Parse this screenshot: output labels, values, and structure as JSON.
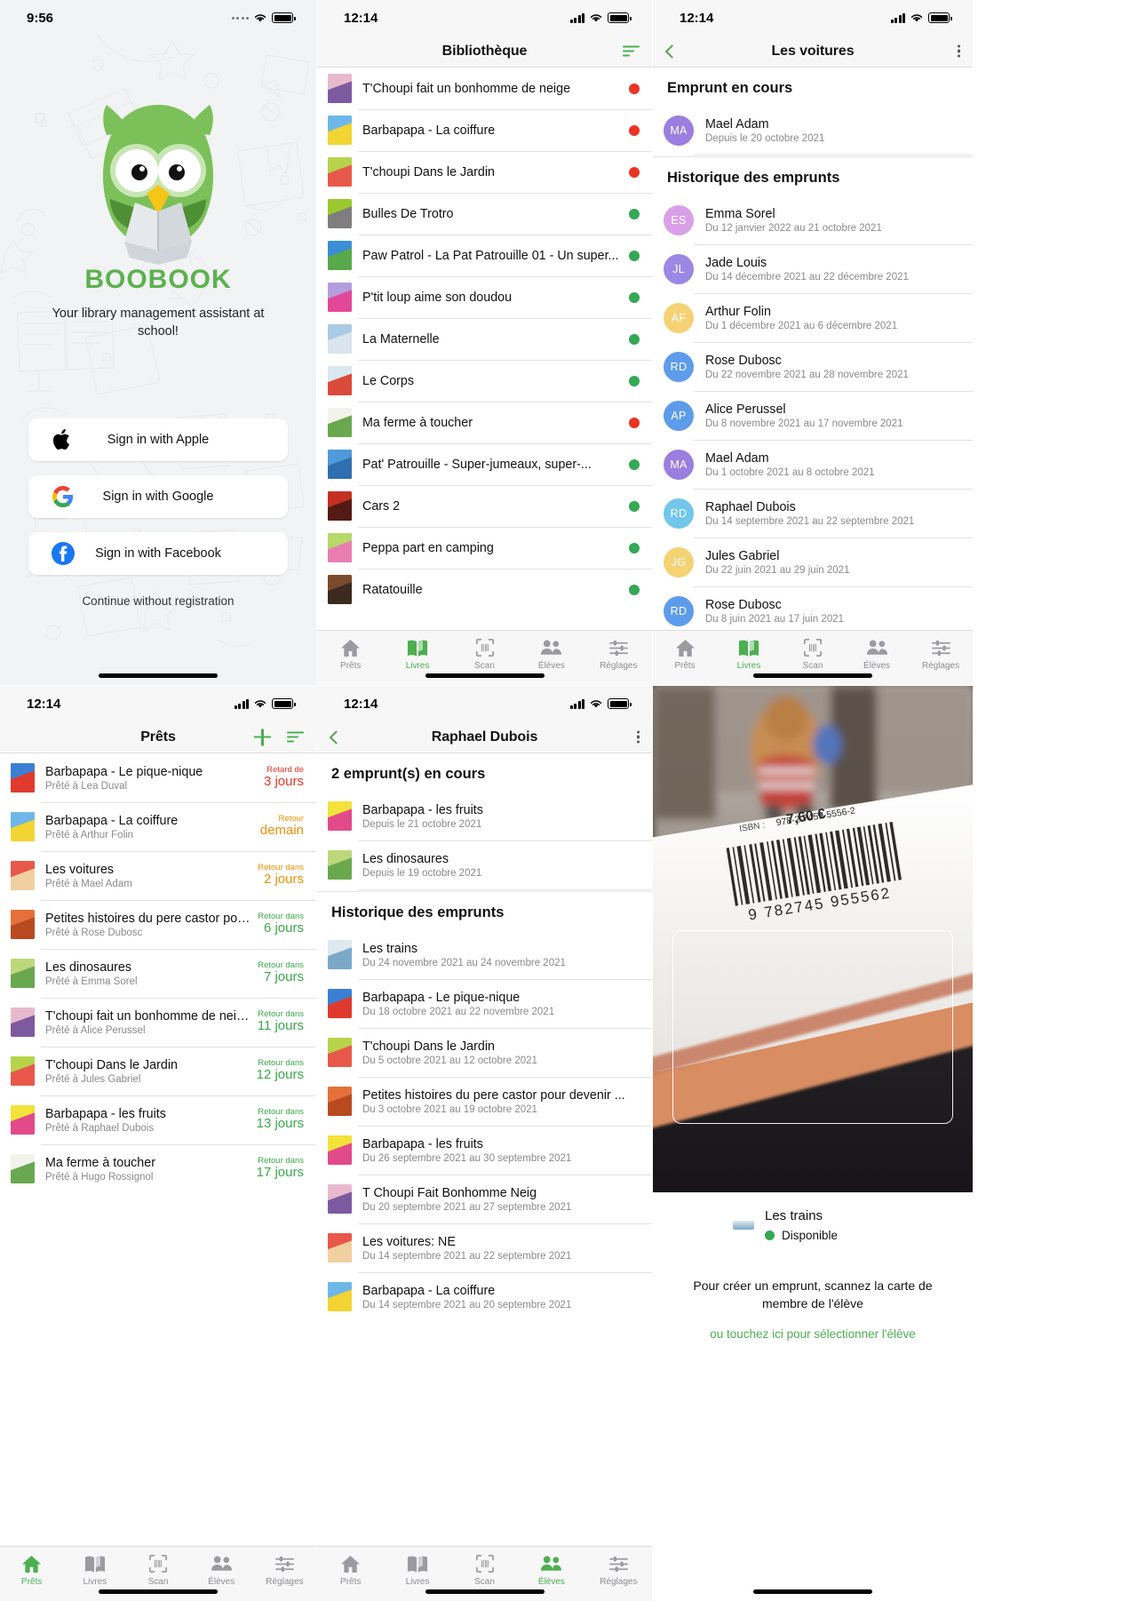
{
  "app": {
    "name": "BOOBOOK",
    "accent": "#4caf50"
  },
  "panel1": {
    "status": {
      "time": "9:56"
    },
    "brand": "BOOBOOK",
    "tagline": "Your library management assistant at school!",
    "buttons": [
      {
        "label": "Sign in with Apple",
        "icon": "apple-icon"
      },
      {
        "label": "Sign in with Google",
        "icon": "google-icon"
      },
      {
        "label": "Sign in with Facebook",
        "icon": "facebook-icon"
      }
    ],
    "continue": "Continue without registration"
  },
  "panel2": {
    "status": {
      "time": "12:14"
    },
    "title": "Bibliothèque",
    "sort_icon": "sort-icon",
    "books": [
      {
        "title": "T'Choupi fait un bonhomme de neige",
        "status": "red",
        "c1": "#e8b9cd",
        "c2": "#7d5aa0"
      },
      {
        "title": "Barbapapa - La coiffure",
        "status": "red",
        "c1": "#6fb7e8",
        "c2": "#f2d432"
      },
      {
        "title": "T'choupi Dans le Jardin",
        "status": "red",
        "c1": "#b7d34a",
        "c2": "#e8584a"
      },
      {
        "title": "Bulles De Trotro",
        "status": "green",
        "c1": "#9bc82e",
        "c2": "#7e7e7e"
      },
      {
        "title": "Paw Patrol - La Pat Patrouille 01 - Un super...",
        "status": "green",
        "c1": "#3b8fd4",
        "c2": "#59a94a"
      },
      {
        "title": "P'tit loup aime son doudou",
        "status": "green",
        "c1": "#b49ddb",
        "c2": "#e2489a"
      },
      {
        "title": "La Maternelle",
        "status": "green",
        "c1": "#aacbe3",
        "c2": "#d9e4ec"
      },
      {
        "title": "Le Corps",
        "status": "green",
        "c1": "#d9e7f0",
        "c2": "#d94a3a"
      },
      {
        "title": "Ma ferme à toucher",
        "status": "red",
        "c1": "#f3f3ee",
        "c2": "#6aa84f"
      },
      {
        "title": "Pat' Patrouille - Super-jumeaux, super-...",
        "status": "green",
        "c1": "#4f9ad8",
        "c2": "#2f6fae"
      },
      {
        "title": "Cars 2",
        "status": "green",
        "c1": "#c43022",
        "c2": "#541a14"
      },
      {
        "title": "Peppa part en camping",
        "status": "green",
        "c1": "#b6d96a",
        "c2": "#e87fb0"
      },
      {
        "title": "Ratatouille",
        "status": "green",
        "c1": "#7a4a2c",
        "c2": "#3a2a20"
      }
    ],
    "tabs": [
      {
        "label": "Prêts",
        "icon": "home-icon",
        "active": false
      },
      {
        "label": "Livres",
        "icon": "book-icon",
        "active": true
      },
      {
        "label": "Scan",
        "icon": "scan-icon",
        "active": false
      },
      {
        "label": "Élèves",
        "icon": "people-icon",
        "active": false
      },
      {
        "label": "Réglages",
        "icon": "sliders-icon",
        "active": false
      }
    ]
  },
  "panel3": {
    "status": {
      "time": "12:14"
    },
    "title": "Les voitures",
    "back_icon": "chevron-left-icon",
    "menu_icon": "more-vertical-icon",
    "current_header": "Emprunt en cours",
    "current": [
      {
        "name": "Mael Adam",
        "date": "Depuis le 20 octobre 2021",
        "initials": "MA",
        "color": "#9b7ee0"
      }
    ],
    "history_header": "Historique des emprunts",
    "history": [
      {
        "name": "Emma Sorel",
        "date": "Du 12 janvier 2022 au 21 octobre 2021",
        "initials": "ES",
        "color": "#d9a0e8"
      },
      {
        "name": "Jade Louis",
        "date": "Du 14 décembre 2021 au 22 décembre 2021",
        "initials": "JL",
        "color": "#9b88e4"
      },
      {
        "name": "Arthur Folin",
        "date": "Du 1 décembre 2021 au 6 décembre 2021",
        "initials": "AF",
        "color": "#f5d274"
      },
      {
        "name": "Rose Dubosc",
        "date": "Du 22 novembre 2021 au 28 novembre 2021",
        "initials": "RD",
        "color": "#5d9cea"
      },
      {
        "name": "Alice Perussel",
        "date": "Du 8 novembre 2021 au 17 novembre 2021",
        "initials": "AP",
        "color": "#5d9cea"
      },
      {
        "name": "Mael Adam",
        "date": "Du 1 octobre 2021 au 8 octobre 2021",
        "initials": "MA",
        "color": "#9b7ee0"
      },
      {
        "name": "Raphael Dubois",
        "date": "Du 14 septembre 2021 au 22 septembre 2021",
        "initials": "RD",
        "color": "#72c6ec"
      },
      {
        "name": "Jules Gabriel",
        "date": "Du 22 juin 2021 au 29 juin 2021",
        "initials": "JG",
        "color": "#f5d274"
      },
      {
        "name": "Rose Dubosc",
        "date": "Du 8 juin 2021 au 17 juin 2021",
        "initials": "RD",
        "color": "#5d9cea"
      }
    ],
    "tabs": [
      {
        "label": "Prêts",
        "icon": "home-icon",
        "active": false
      },
      {
        "label": "Livres",
        "icon": "book-icon",
        "active": true
      },
      {
        "label": "Scan",
        "icon": "scan-icon",
        "active": false
      },
      {
        "label": "Élèves",
        "icon": "people-icon",
        "active": false
      },
      {
        "label": "Réglages",
        "icon": "sliders-icon",
        "active": false
      }
    ]
  },
  "panel4": {
    "status": {
      "time": "12:14"
    },
    "title": "Prêts",
    "add_icon": "plus-icon",
    "sort_icon": "sort-icon",
    "loans": [
      {
        "title": "Barbapapa - Le pique-nique",
        "sub": "Prêté à Lea Duval",
        "label": "Retard de",
        "value": "3 jours",
        "color": "#ea3323",
        "c1": "#3b7fd4",
        "c2": "#e03a2f"
      },
      {
        "title": "Barbapapa - La coiffure",
        "sub": "Prêté à Arthur Folin",
        "label": "Retour",
        "value": "demain",
        "color": "#f09000",
        "c1": "#6fb7e8",
        "c2": "#f2d432"
      },
      {
        "title": "Les voitures",
        "sub": "Prêté à Mael Adam",
        "label": "Retour dans",
        "value": "2 jours",
        "color": "#f09000",
        "c1": "#e8584a",
        "c2": "#f0d0a0"
      },
      {
        "title": "Petites histoires du pere castor pour ...",
        "sub": "Prêté à Rose Dubosc",
        "label": "Retour dans",
        "value": "6 jours",
        "color": "#3aa94a",
        "c1": "#e5703a",
        "c2": "#b84a20"
      },
      {
        "title": "Les dinosaures",
        "sub": "Prêté à Emma Sorel",
        "label": "Retour dans",
        "value": "7 jours",
        "color": "#3aa94a",
        "c1": "#bcd87a",
        "c2": "#6aa84f"
      },
      {
        "title": "T'choupi fait un bonhomme de neige",
        "sub": "Prêté à Alice Perussel",
        "label": "Retour dans",
        "value": "11 jours",
        "color": "#3aa94a",
        "c1": "#e8b9cd",
        "c2": "#7d5aa0"
      },
      {
        "title": "T'choupi Dans le Jardin",
        "sub": "Prêté à Jules Gabriel",
        "label": "Retour dans",
        "value": "12 jours",
        "color": "#3aa94a",
        "c1": "#b7d34a",
        "c2": "#e8584a"
      },
      {
        "title": "Barbapapa - les fruits",
        "sub": "Prêté à Raphael Dubois",
        "label": "Retour dans",
        "value": "13 jours",
        "color": "#3aa94a",
        "c1": "#f2e23a",
        "c2": "#e24a8a"
      },
      {
        "title": "Ma ferme à toucher",
        "sub": "Prêté à Hugo Rossignol",
        "label": "Retour dans",
        "value": "17 jours",
        "color": "#3aa94a",
        "c1": "#f3f3ee",
        "c2": "#6aa84f"
      }
    ],
    "tabs": [
      {
        "label": "Prêts",
        "icon": "home-icon",
        "active": true
      },
      {
        "label": "Livres",
        "icon": "book-icon",
        "active": false
      },
      {
        "label": "Scan",
        "icon": "scan-icon",
        "active": false
      },
      {
        "label": "Élèves",
        "icon": "people-icon",
        "active": false
      },
      {
        "label": "Réglages",
        "icon": "sliders-icon",
        "active": false
      }
    ]
  },
  "panel5": {
    "status": {
      "time": "12:14"
    },
    "title": "Raphael Dubois",
    "back_icon": "chevron-left-icon",
    "menu_icon": "more-vertical-icon",
    "current_header": "2 emprunt(s) en cours",
    "current": [
      {
        "title": "Barbapapa - les fruits",
        "date": "Depuis le 21 octobre 2021",
        "c1": "#f2e23a",
        "c2": "#e24a8a"
      },
      {
        "title": "Les dinosaures",
        "date": "Depuis le 19 octobre 2021",
        "c1": "#bcd87a",
        "c2": "#6aa84f"
      }
    ],
    "history_header": "Historique des emprunts",
    "history": [
      {
        "title": "Les trains",
        "date": "Du 24 novembre 2021 au 24 novembre 2021",
        "c1": "#dfe8ef",
        "c2": "#7aa8c8"
      },
      {
        "title": "Barbapapa - Le pique-nique",
        "date": "Du 18 octobre 2021 au 22 novembre 2021",
        "c1": "#3b7fd4",
        "c2": "#e03a2f"
      },
      {
        "title": "T'choupi Dans le Jardin",
        "date": "Du 5 octobre 2021 au 12 octobre 2021",
        "c1": "#b7d34a",
        "c2": "#e8584a"
      },
      {
        "title": "Petites histoires du pere castor pour devenir ...",
        "date": "Du 3 octobre 2021 au 19 octobre 2021",
        "c1": "#e5703a",
        "c2": "#b84a20"
      },
      {
        "title": "Barbapapa - les fruits",
        "date": "Du 26 septembre 2021 au 30 septembre 2021",
        "c1": "#f2e23a",
        "c2": "#e24a8a"
      },
      {
        "title": "T Choupi Fait Bonhomme Neig",
        "date": "Du 20 septembre 2021 au 27 septembre 2021",
        "c1": "#e8b9cd",
        "c2": "#7d5aa0"
      },
      {
        "title": "Les voitures: NE",
        "date": "Du 14 septembre 2021 au 22 septembre 2021",
        "c1": "#e8584a",
        "c2": "#f0d0a0"
      },
      {
        "title": "Barbapapa - La coiffure",
        "date": "Du 14 septembre 2021 au 20 septembre 2021",
        "c1": "#6fb7e8",
        "c2": "#f2d432"
      }
    ],
    "tabs": [
      {
        "label": "Prêts",
        "icon": "home-icon",
        "active": false
      },
      {
        "label": "Livres",
        "icon": "book-icon",
        "active": false
      },
      {
        "label": "Scan",
        "icon": "scan-icon",
        "active": false
      },
      {
        "label": "Élèves",
        "icon": "people-icon",
        "active": true
      },
      {
        "label": "Réglages",
        "icon": "sliders-icon",
        "active": false
      }
    ]
  },
  "panel6": {
    "barcode": {
      "price": "7,60 €",
      "isbn_label": "ISBN :",
      "isbn": "978-2-7459-5556-2",
      "digits": "9 782745 955562"
    },
    "book_title": "Les trains",
    "availability": "Disponible",
    "availability_color": "#34a853",
    "hint": "Pour créer un emprunt, scannez la carte de membre de l'élève",
    "link": "ou touchez ici pour sélectionner l'élève"
  }
}
